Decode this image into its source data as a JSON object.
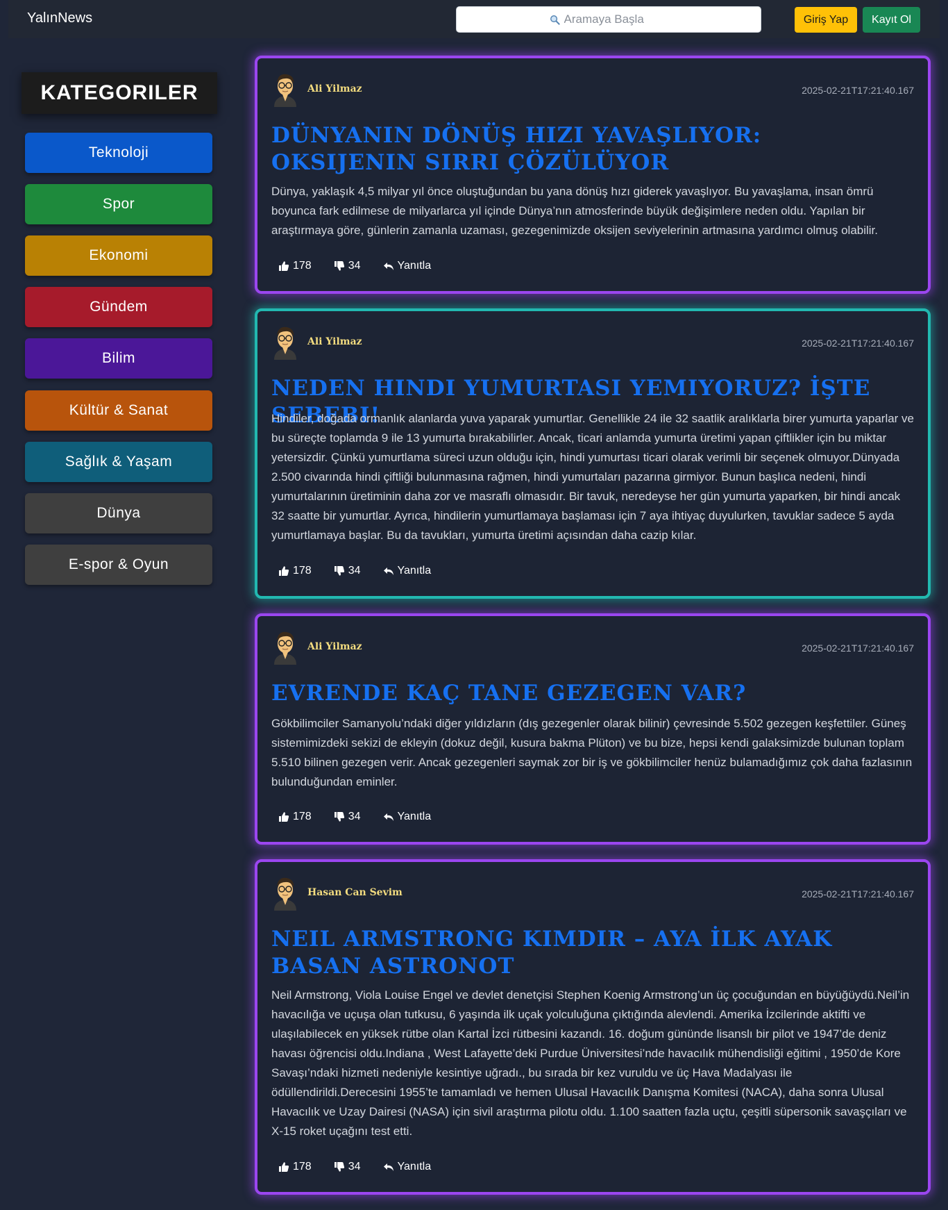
{
  "navbar": {
    "brand": "YalınNews",
    "search_placeholder": "Aramaya Başla",
    "login_label": "Giriş Yap",
    "register_label": "Kayıt Ol"
  },
  "sidebar": {
    "title": "KATEGORILER",
    "categories": [
      {
        "label": "Teknoloji",
        "color": "#0a58ca"
      },
      {
        "label": "Spor",
        "color": "#1e8a3c"
      },
      {
        "label": "Ekonomi",
        "color": "#b98104"
      },
      {
        "label": "Gündem",
        "color": "#a61b2b"
      },
      {
        "label": "Bilim",
        "color": "#4b1798"
      },
      {
        "label": "Kültür & Sanat",
        "color": "#b8540c"
      },
      {
        "label": "Sağlık & Yaşam",
        "color": "#0f5e7a"
      },
      {
        "label": "Dünya",
        "color": "#3f3f3f"
      },
      {
        "label": "E-spor & Oyun",
        "color": "#3f3f3f"
      }
    ]
  },
  "posts": [
    {
      "author": "Ali Yilmaz",
      "date": "2025-02-21T17:21:40.167",
      "title": "Dünyanın Dönüş Hızı Yavaşlıyor: Oksijenin Sırrı Çözülüyor",
      "body": "Dünya, yaklaşık 4,5 milyar yıl önce oluştuğundan bu yana dönüş hızı giderek yavaşlıyor. Bu yavaşlama, insan ömrü boyunca fark edilmese de milyarlarca yıl içinde Dünya’nın atmosferinde büyük değişimlere neden oldu. Yapılan bir araştırmaya göre, günlerin zamanla uzaması, gezegenimizde oksijen seviyelerinin artmasına yardımcı olmuş olabilir.",
      "likes": "178",
      "dislikes": "34",
      "reply_label": "Yanıtla",
      "accent": "#9b46f0"
    },
    {
      "author": "Ali Yilmaz",
      "date": "2025-02-21T17:21:40.167",
      "title": "Neden Hindi Yumurtası Yemiyoruz? İşte Sebebi!",
      "body": "Hindiler, doğada ormanlık alanlarda yuva yaparak yumurtlar. Genellikle 24 ile 32 saatlik aralıklarla birer yumurta yaparlar ve bu süreçte toplamda 9 ile 13 yumurta bırakabilirler. Ancak, ticari anlamda yumurta üretimi yapan çiftlikler için bu miktar yetersizdir. Çünkü yumurtlama süreci uzun olduğu için, hindi yumurtası ticari olarak verimli bir seçenek olmuyor.Dünyada 2.500 civarında hindi çiftliği bulunmasına rağmen, hindi yumurtaları pazarına girmiyor. Bunun başlıca nedeni, hindi yumurtalarının üretiminin daha zor ve masraflı olmasıdır. Bir tavuk, neredeyse her gün yumurta yaparken, bir hindi ancak 32 saatte bir yumurtlar. Ayrıca, hindilerin yumurtlamaya başlaması için 7 aya ihtiyaç duyulurken, tavuklar sadece 5 ayda yumurtlamaya başlar. Bu da tavukları, yumurta üretimi açısından daha cazip kılar.",
      "likes": "178",
      "dislikes": "34",
      "reply_label": "Yanıtla",
      "accent": "#22b8b0"
    },
    {
      "author": "Ali Yilmaz",
      "date": "2025-02-21T17:21:40.167",
      "title": "Evrende Kaç Tane Gezegen Var?",
      "body": "Gökbilimciler Samanyolu’ndaki diğer yıldızların (dış gezegenler olarak bilinir) çevresinde 5.502 gezegen keşfettiler. Güneş sistemimizdeki sekizi de ekleyin (dokuz değil, kusura bakma Plüton) ve bu bize, hepsi kendi galaksimizde bulunan toplam 5.510 bilinen gezegen verir. Ancak gezegenleri saymak zor bir iş ve gökbilimciler henüz bulamadığımız çok daha fazlasının bulunduğundan eminler.",
      "likes": "178",
      "dislikes": "34",
      "reply_label": "Yanıtla",
      "accent": "#9b46f0"
    },
    {
      "author": "Hasan Can Sevim",
      "date": "2025-02-21T17:21:40.167",
      "title": "Neil Armstrong Kimdir – Aya İlk Ayak Basan Astronot",
      "body": "Neil Armstrong, Viola Louise Engel ve devlet denetçisi Stephen Koenig Armstrong’un üç çocuğundan en büyüğüydü.Neil’in havacılığa ve uçuşa olan tutkusu, 6 yaşında ilk uçak yolculuğuna çıktığında alevlendi. Amerika İzcilerinde aktifti ve ulaşılabilecek en yüksek rütbe olan Kartal İzci rütbesini kazandı. 16. doğum gününde lisanslı bir pilot ve 1947’de deniz havası öğrencisi oldu.Indiana , West Lafayette’deki Purdue Üniversitesi’nde havacılık mühendisliği eğitimi , 1950’de Kore Savaşı’ndaki hizmeti nedeniyle kesintiye uğradı., bu sırada bir kez vuruldu ve üç Hava Madalyası ile ödüllendirildi.Derecesini 1955’te tamamladı ve hemen Ulusal Havacılık Danışma Komitesi (NACA), daha sonra Ulusal Havacılık ve Uzay Dairesi (NASA) için sivil araştırma pilotu oldu. 1.100 saatten fazla uçtu, çeşitli süpersonik savaşçıları ve X-15 roket uçağını test etti.",
      "likes": "178",
      "dislikes": "34",
      "reply_label": "Yanıtla",
      "accent": "#9b46f0"
    }
  ]
}
